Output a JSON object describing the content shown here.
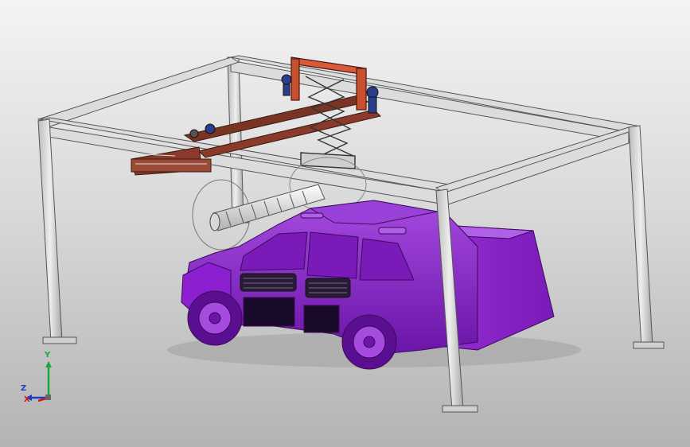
{
  "viewport": {
    "background_top": "#f4f4f4",
    "background_bottom": "#b4b4b4"
  },
  "model": {
    "frame_color": "#d8d8d8",
    "frame_edge_color": "#555555",
    "gantry_color": "#8a3a2a",
    "carriage_color": "#d85a3a",
    "motor_color": "#2a3e8a",
    "car_body_color": "#8c1fd1",
    "car_dark_color": "#5a0f90",
    "car_light_color": "#a64ae0",
    "brush_color": "#e6e6e6"
  },
  "triad": {
    "y_label": "Y",
    "z_label": "Z",
    "x_label": "X",
    "y_color": "#1aa83a",
    "z_color": "#1a3ecc",
    "x_color": "#d41a1a"
  }
}
